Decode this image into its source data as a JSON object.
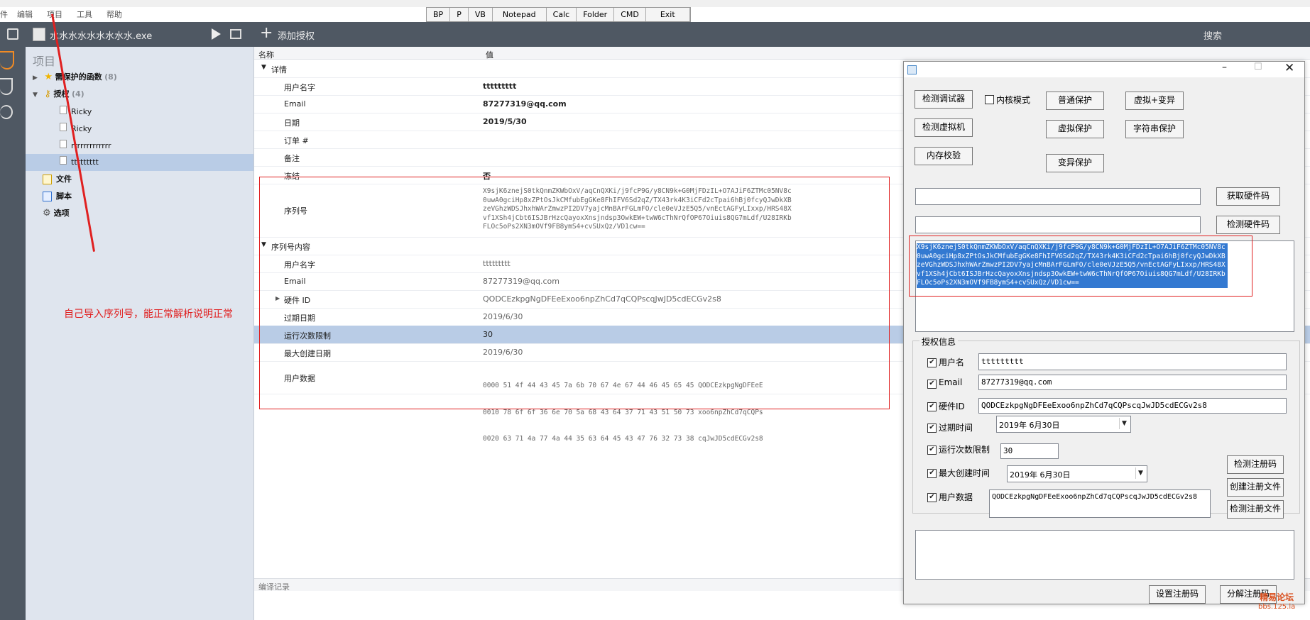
{
  "menubar": {
    "items": [
      "件",
      "编辑",
      "项目",
      "工具",
      "帮助"
    ]
  },
  "quickbar": {
    "buttons": [
      "BP",
      "P",
      "VB",
      "Notepad",
      "Calc",
      "Folder",
      "CMD",
      "Exit"
    ]
  },
  "toolbar": {
    "project_file": "水水水水水水水水水.exe",
    "add_license": "添加授权",
    "search": "搜索"
  },
  "tree": {
    "header": "项目",
    "protected_functions": "需保护的函数",
    "protected_count": "(8)",
    "licenses": "授权",
    "licenses_count": "(4)",
    "license_items": [
      "Ricky",
      "Ricky",
      "rrrrrrrrrrrrr",
      "ttttttttt"
    ],
    "files": "文件",
    "script": "脚本",
    "options": "选项"
  },
  "table": {
    "col_name": "名称",
    "col_value": "值",
    "section_details": "详情",
    "username_label": "用户名字",
    "username_value": "ttttttttt",
    "email_label": "Email",
    "email_value": "87277319@qq.com",
    "date_label": "日期",
    "date_value": "2019/5/30",
    "order_label": "订单 #",
    "remark_label": "备注",
    "blocked_label": "冻结",
    "blocked_value": "否",
    "serial_label": "序列号",
    "serial_lines": [
      "X9sjK6znejS0tkQnmZKWbOxV/aqCnQXKi/j9fcP9G/y8CN9k+G0MjFDzIL+O7AJiF6ZTMc05NV8c",
      "0uwA0gciHp8xZPtOsJkCMfubEgGKe8FhIFV6Sd2qZ/TX43rk4K3iCFd2cTpai6hBj0fcyQJwDkXB",
      "zeVGhzWDSJhxhWArZmwzPI2DV7yajcMnBArFGLmFO/cle0eVJzE5Q5/vnEctAGFyLIxxp/HRS48X",
      "vf1XSh4jCbt6ISJBrHzcQayoxXnsjndsp3OwkEW+twW6cThNrQfOP67Oiuis8QG7mLdf/U28IRKb",
      "FLOc5oPs2XN3mOVf9FB8ymS4+cvSUxQz/VD1cw=="
    ],
    "section_serial": "序列号内容",
    "sc_username_label": "用户名字",
    "sc_username_value": "ttttttttt",
    "sc_email_label": "Email",
    "sc_email_value": "87277319@qq.com",
    "hwid_label": "硬件 ID",
    "hwid_value": "QODCEzkpgNgDFEeExoo6npZhCd7qCQPscqJwJD5cdECGv2s8",
    "expire_label": "过期日期",
    "expire_value": "2019/6/30",
    "runlimit_label": "运行次数限制",
    "runlimit_value": "30",
    "maxbuild_label": "最大创建日期",
    "maxbuild_value": "2019/6/30",
    "userdata_label": "用户数据",
    "userdata_lines": [
      "0000 51 4f 44 43 45 7a 6b 70 67 4e 67 44 46 45 65 45 QODCEzkpgNgDFEeE",
      "0010 78 6f 6f 36 6e 70 5a 68 43 64 37 71 43 51 50 73 xoo6npZhCd7qCQPs",
      "0020 63 71 4a 77 4a 44 35 63 64 45 43 47 76 32 73 38 cqJwJD5cdECGv2s8"
    ],
    "compile_log": "编译记录"
  },
  "annotation": {
    "note": "自己导入序列号，能正常解析说明正常"
  },
  "dialog": {
    "btn_detect_debugger": "检测调试器",
    "kernel_mode": "内核模式",
    "btn_normal_protect": "普通保护",
    "btn_virt_mutate": "虚拟+变异",
    "btn_detect_vm": "检测虚拟机",
    "btn_virt_protect": "虚拟保护",
    "btn_string_protect": "字符串保护",
    "btn_mem_check": "内存校验",
    "btn_mutate_protect": "变异保护",
    "btn_get_hwid": "获取硬件码",
    "btn_check_hwid": "检测硬件码",
    "serial_text": "X9sjK6znejS0tkQnmZKWbOxV/aqCnQXKi/j9fcP9G/y8CN9k+G0MjFDzIL+O7AJiF6ZTMc05NV8c0uwA0gciHp8xZPtOsJkCMfubEgGKe8FhIFV6Sd2qZ/TX43rk4K3iCFd2cTpai6hBj0fcyQJwDkXBzeVGhzWDSJhxhWArZmwzPI2DV7yajcMnBArFGLmFO/cle0eVJzE5Q5/vnEctAGFyLIxxp/HRS48Xvf1XSh4jCbt6ISJBrHzcQayoxXnsjndsp3OwkEW+twW6cThNrQfOP67Oiuis8QG7mLdf/U28IRKbFLOc5oPs2XN3mOVf9FB8ymS4+cvSUxQz/VD1cw==",
    "group_license": "授权信息",
    "username_label": "用户名",
    "username_value": "ttttttttt",
    "email_label": "Email",
    "email_value": "87277319@qq.com",
    "hwid_label": "硬件ID",
    "hwid_value": "QODCEzkpgNgDFEeExoo6npZhCd7qCQPscqJwJD5cdECGv2s8",
    "expire_label": "过期时间",
    "expire_value": "2019年 6月30日",
    "runlimit_label": "运行次数限制",
    "runlimit_value": "30",
    "maxbuild_label": "最大创建时间",
    "maxbuild_value": "2019年 6月30日",
    "userdata_label": "用户数据",
    "userdata_value": "QODCEzkpgNgDFEeExoo6npZhCd7qCQPscqJwJD5cdECGv2s8",
    "btn_check_regcode": "检测注册码",
    "btn_create_regfile": "创建注册文件",
    "btn_check_regfile": "检测注册文件",
    "btn_set_regcode": "设置注册码",
    "btn_decompose_regcode": "分解注册码"
  },
  "watermark": {
    "line1": "精易论坛",
    "line2": "bbs.125.la"
  }
}
